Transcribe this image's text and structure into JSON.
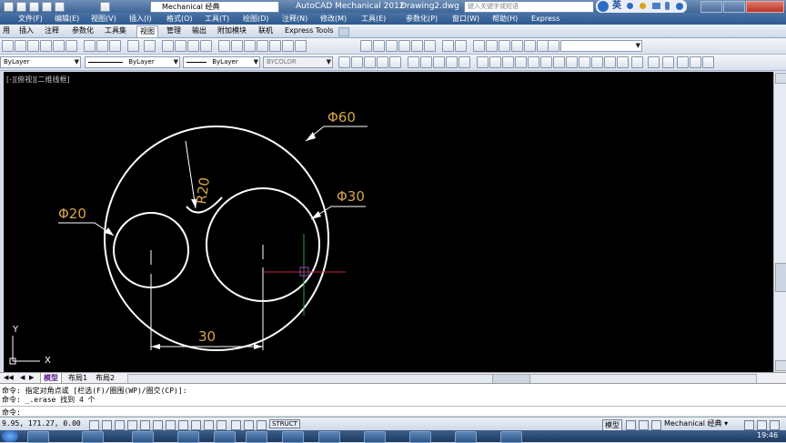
{
  "title_bar": {
    "workspace": "Mechanical 经典",
    "app_title": "AutoCAD Mechanical 2012",
    "doc_title": "Drawing2.dwg",
    "search_placeholder": "键入关键字或短语",
    "ime_label": "英"
  },
  "menu": [
    "文件(F)",
    "编辑(E)",
    "视图(V)",
    "插入(I)",
    "格式(O)",
    "工具(T)",
    "绘图(D)",
    "注释(N)",
    "修改(M)",
    "工具(E)",
    "参数化(P)",
    "窗口(W)",
    "帮助(H)",
    "Express"
  ],
  "ribbon_tabs": [
    "用",
    "插入",
    "注释",
    "参数化",
    "工具集",
    "视图",
    "管理",
    "输出",
    "附加模块",
    "联机",
    "Express Tools"
  ],
  "active_ribbon_tab": "视图",
  "layer_props": {
    "layer": "ByLayer",
    "linetype": "ByLayer",
    "lineweight": "ByLayer",
    "color": "BYCOLOR"
  },
  "viewport_label": "[-][俯视][二维线框]",
  "drawing": {
    "dim_labels": {
      "large_circle": "Φ60",
      "right_circle": "Φ30",
      "left_circle": "Φ20",
      "radius": "R20",
      "distance": "30"
    },
    "colors": {
      "background": "#000000",
      "geometry": "#ffffff",
      "dimension_text": "#d4a646",
      "crosshair_x": "#c8283a",
      "crosshair_y": "#2e9a3a",
      "pickbox": "#9a3cc8"
    }
  },
  "ucs": {
    "x_label": "X",
    "y_label": "Y"
  },
  "layout_tabs": [
    "模型",
    "布局1",
    "布局2"
  ],
  "active_layout_tab": "模型",
  "command_history": [
    "命令: 指定对角点或 [栏选(F)/圈围(WP)/圈交(CP)]:",
    "命令: _.erase 找到 4 个",
    "命令:"
  ],
  "status": {
    "coordinates": "9.95, 171.27, 0.00",
    "struct_label": "STRUCT",
    "model_label": "模型",
    "workspace": "Mechanical 经典",
    "clock": "19:46"
  }
}
